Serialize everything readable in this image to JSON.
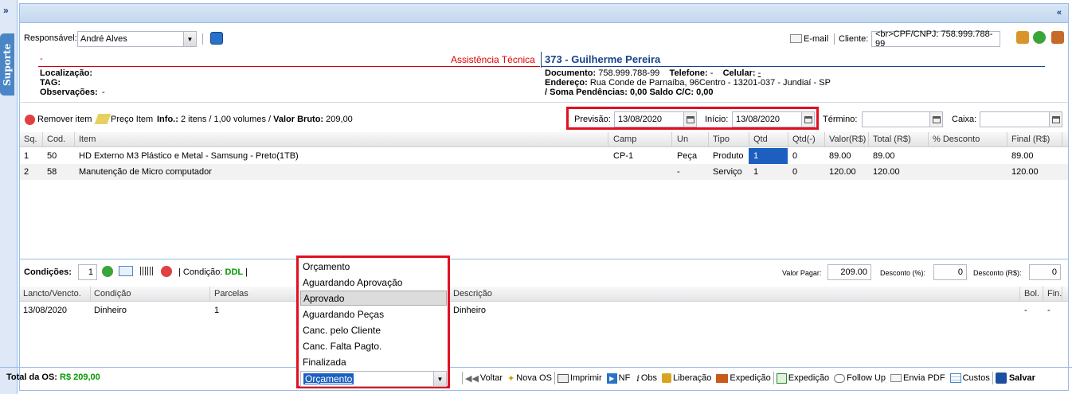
{
  "sidebar": {
    "expand": "»",
    "suporte": "Suporte"
  },
  "header": {
    "collapse": "«"
  },
  "toolbar": {
    "responsavel_label": "Responsável:",
    "responsavel_value": "André Alves",
    "email_label": "E-mail",
    "cliente_label": "Cliente:",
    "cliente_value": "<br>CPF/CNPJ: 758.999.788-99"
  },
  "info": {
    "dash": "-",
    "section": "Assistência Técnica",
    "localizacao": "Localização:",
    "tag": "TAG:",
    "observacoes": "Observações:",
    "observacoes_value": "-",
    "client_title": "373 - Guilherme Pereira",
    "documento_label": "Documento:",
    "documento_value": "758.999.788-99",
    "telefone_label": "Telefone:",
    "telefone_value": "-",
    "celular_label": "Celular:",
    "celular_value": "-",
    "endereco_label": "Endereço:",
    "endereco_value": "Rua Conde de Parnaíba, 96Centro - 13201-037 - Jundiaí - SP",
    "pendencias": "/ Soma Pendências: 0,00 Saldo C/C: 0,00"
  },
  "items_toolbar": {
    "remover": "Remover item",
    "preco": "Preço Item",
    "info_label": "Info.:",
    "info_value": "2 itens / 1,00 volumes /",
    "valor_bruto_label": "Valor Bruto:",
    "valor_bruto_value": "209,00",
    "previsao_label": "Previsão:",
    "previsao_value": "13/08/2020",
    "inicio_label": "Início:",
    "inicio_value": "13/08/2020",
    "termino_label": "Término:",
    "termino_value": "",
    "caixa_label": "Caixa:",
    "caixa_value": ""
  },
  "items_grid": {
    "headers": [
      "Sq.",
      "Cod.",
      "Item",
      "Camp",
      "Un",
      "Tipo",
      "Qtd",
      "Qtd(-)",
      "Valor(R$)",
      "Total (R$)",
      "% Desconto",
      "Final (R$)"
    ],
    "rows": [
      {
        "sq": "1",
        "cod": "50",
        "item": "HD Externo M3 Plástico e Metal - Samsung - Preto(1TB)",
        "camp": "CP-1",
        "un": "Peça",
        "tipo": "Produto",
        "qtd": "1",
        "qtdm": "0",
        "valor": "89.00",
        "total": "89.00",
        "desc": "",
        "final": "89.00"
      },
      {
        "sq": "2",
        "cod": "58",
        "item": "Manutenção de Micro computador",
        "camp": "",
        "un": "-",
        "tipo": "Serviço",
        "qtd": "1",
        "qtdm": "0",
        "valor": "120.00",
        "total": "120.00",
        "desc": "",
        "final": "120.00"
      }
    ]
  },
  "conditions": {
    "label": "Condições:",
    "count": "1",
    "condicao_label": "| Condição:",
    "condicao_value": "DDL",
    "valor_pagar_label": "Valor Pagar:",
    "valor_pagar_value": "209.00",
    "desconto_pct_label": "Desconto (%):",
    "desconto_pct_value": "0",
    "desconto_rs_label": "Desconto (R$):",
    "desconto_rs_value": "0"
  },
  "cond_grid": {
    "headers": [
      "Lancto/Vencto.",
      "Condição",
      "Parcelas",
      "Descrição",
      "Bol.",
      "Fin."
    ],
    "rows": [
      {
        "lancto": "13/08/2020",
        "condicao": "Dinheiro",
        "parcelas": "1",
        "descricao": "Dinheiro",
        "bol": "-",
        "fin": "-"
      }
    ]
  },
  "footer": {
    "total_label": "Total da OS:",
    "total_value": "R$ 209,00",
    "status_value": "Orçamento",
    "buttons": {
      "voltar": "Voltar",
      "nova_os": "Nova OS",
      "imprimir": "Imprimir",
      "nf": "NF",
      "obs": "Obs",
      "liberacao": "Liberação",
      "expedicao1": "Expedição",
      "expedicao2": "Expedição",
      "follow_up": "Follow Up",
      "envia_pdf": "Envia PDF",
      "custos": "Custos",
      "salvar": "Salvar"
    }
  },
  "dropdown": {
    "options": [
      "Orçamento",
      "Aguardando Aprovação",
      "Aprovado",
      "Aguardando Peças",
      "Canc. pelo Cliente",
      "Canc. Falta Pagto.",
      "Finalizada"
    ],
    "hovered": "Aprovado"
  },
  "colors": {
    "accent": "#15428b",
    "highlight": "#e01020",
    "selected_cell": "#1c5fbf",
    "condicao": "#009a00"
  }
}
